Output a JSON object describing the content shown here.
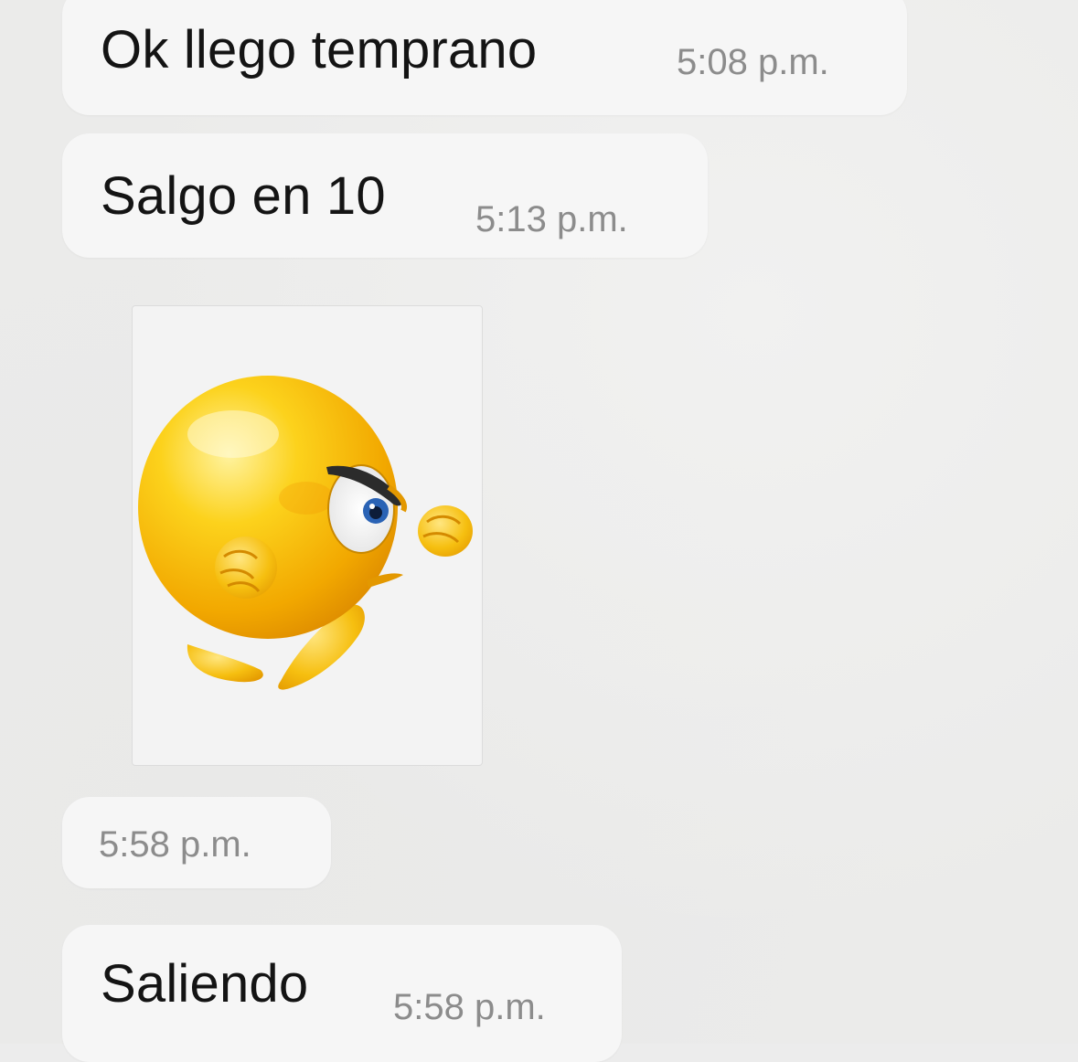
{
  "messages": [
    {
      "text": "Ok llego temprano",
      "time": "5:08 p.m."
    },
    {
      "text": "Salgo en 10",
      "time": "5:13 p.m."
    },
    {
      "sticker": "angry-punching-emoji-sticker",
      "time": "5:58 p.m."
    },
    {
      "text": "Saliendo",
      "time": "5:58 p.m."
    }
  ],
  "colors": {
    "background": "#ebebea",
    "bubble": "#f6f6f6",
    "text": "#141414",
    "timestamp": "#8c8c8c",
    "emoji_yellow": "#f5b800"
  }
}
